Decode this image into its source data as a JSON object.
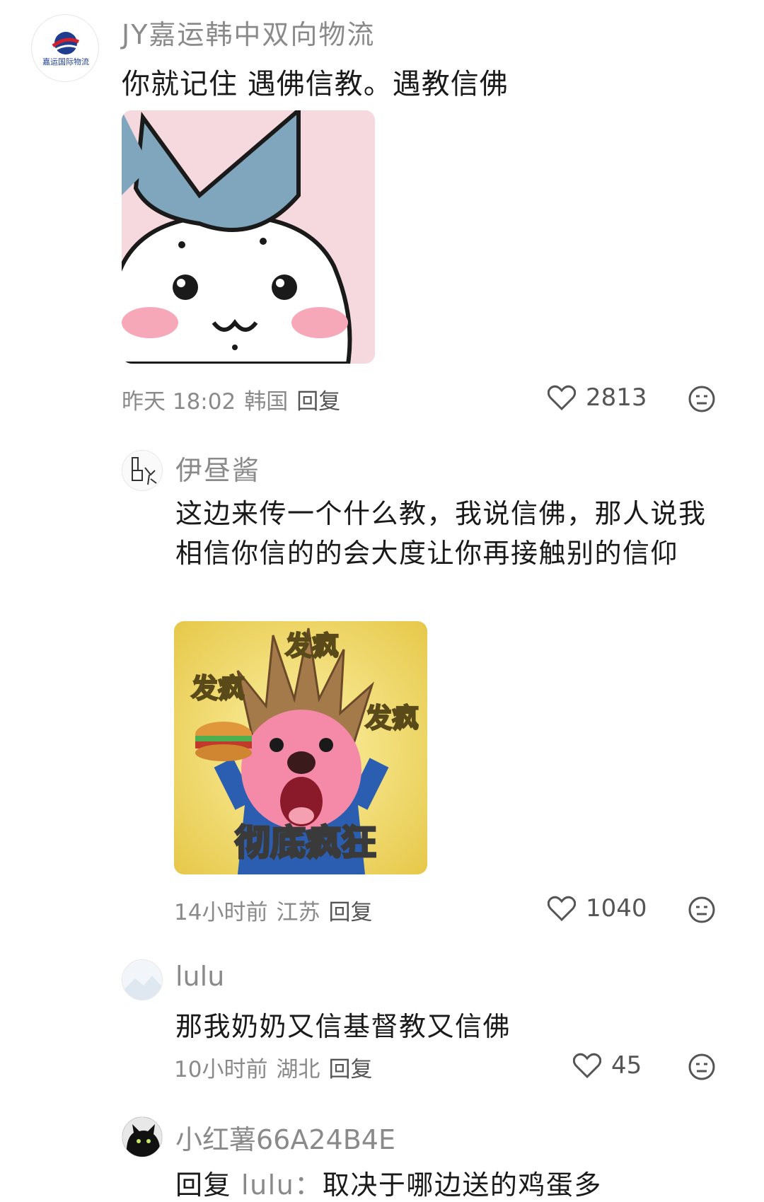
{
  "comments": [
    {
      "username": "JY嘉运韩中双向物流",
      "avatar_label": "嘉运国际物流",
      "text": "你就记住 遇佛信教。遇教信佛",
      "sticker_icon": "bunny-sticker-icon",
      "time": "昨天 18:02",
      "location": "韩国",
      "reply_label": "回复",
      "likes": "2813"
    },
    {
      "username": "伊昼酱",
      "text": "这边来传一个什么教，我说信佛，那人说我相信你信的的会大度让你再接触别的信仰",
      "sticker_icon": "crazy-sticker-icon",
      "sticker_texts": [
        "发疯",
        "发疯",
        "发疯",
        "彻底疯狂"
      ],
      "time": "14小时前",
      "location": "江苏",
      "reply_label": "回复",
      "likes": "1040"
    },
    {
      "username": "lulu",
      "text": "那我奶奶又信基督教又信佛",
      "time": "10小时前",
      "location": "湖北",
      "reply_label": "回复",
      "likes": "45"
    },
    {
      "username": "小红薯66A24B4E",
      "reply_prefix": "回复",
      "mention": "lulu：",
      "text": "取决于哪边送的鸡蛋多"
    }
  ],
  "colors": {
    "meta": "#8a8a8a",
    "text": "#1a1a1a",
    "sticker_bg_1": "#f6d9de",
    "bow": "#7fa6bd"
  }
}
